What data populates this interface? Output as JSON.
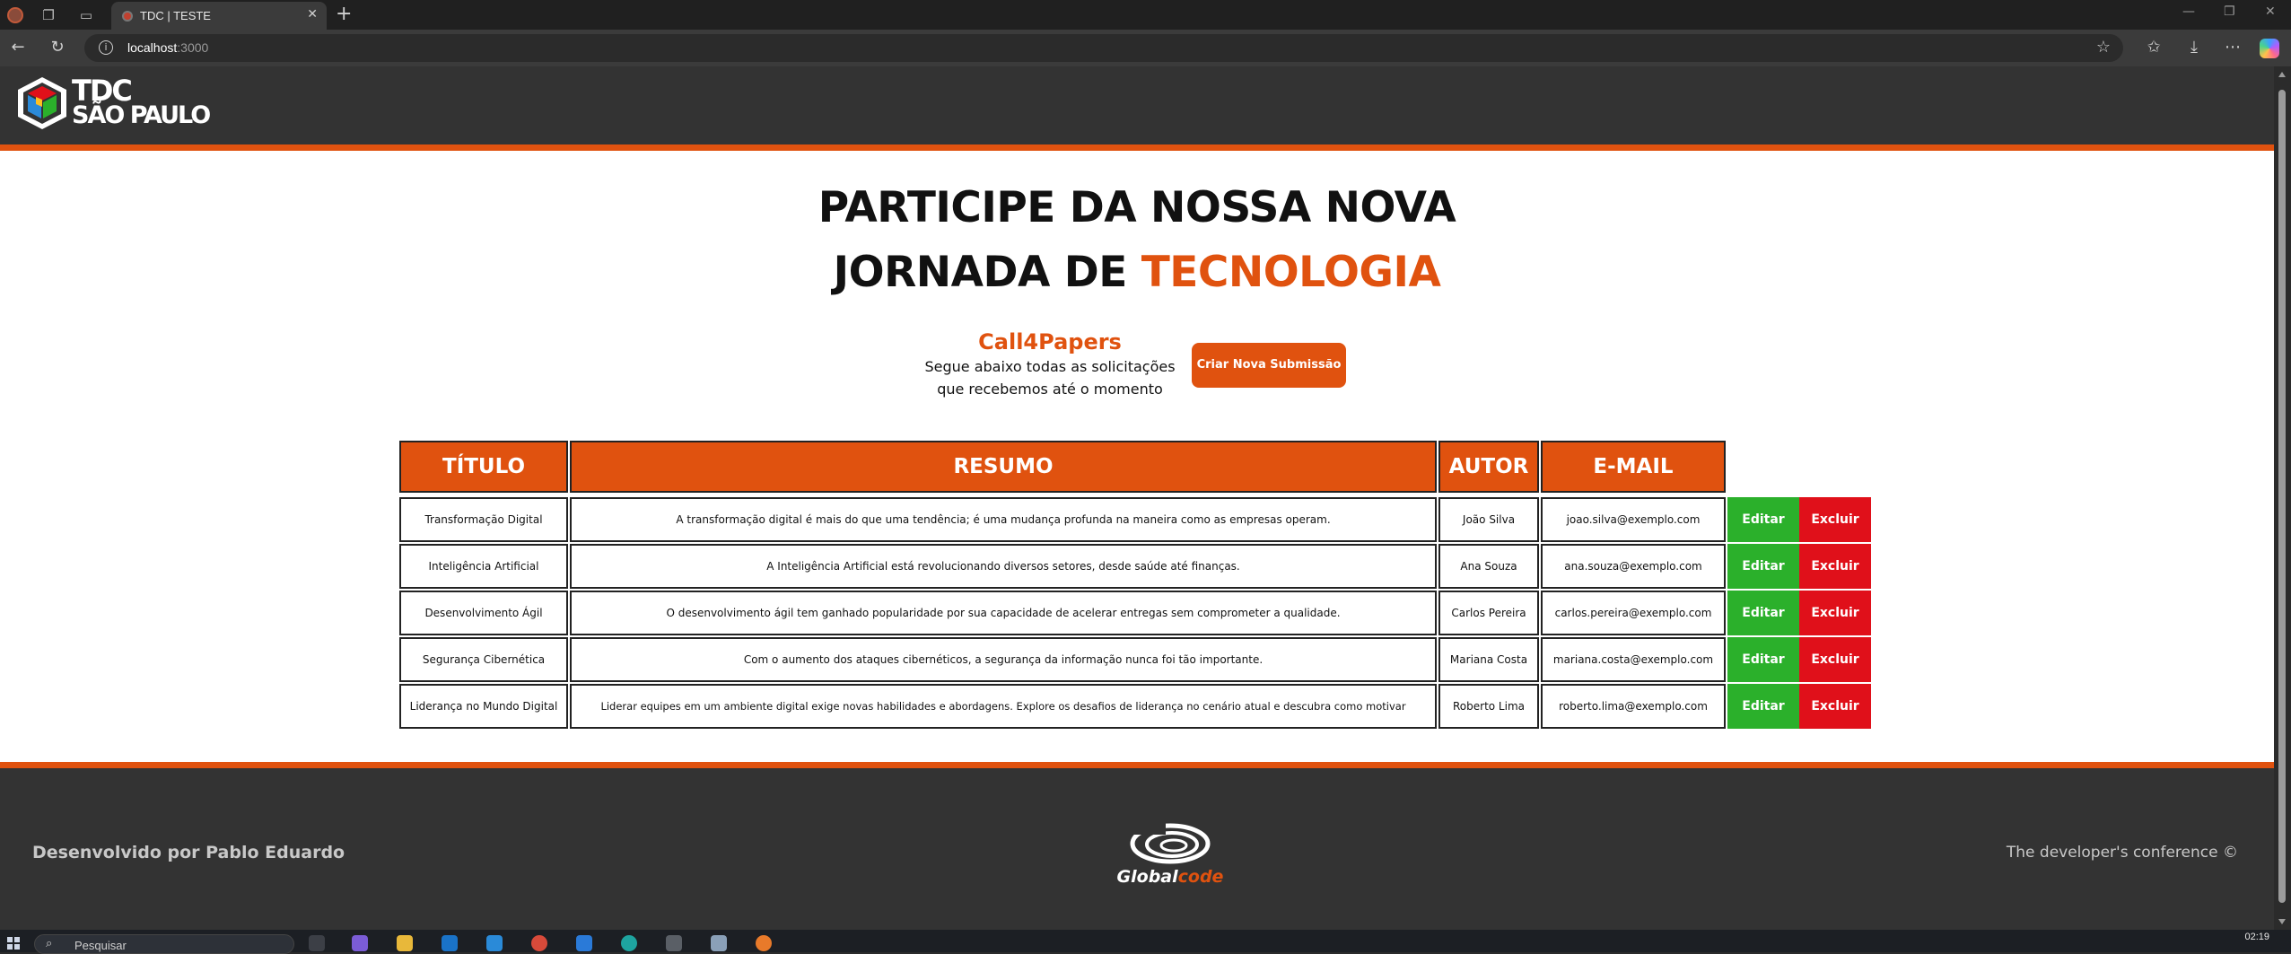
{
  "browser": {
    "tab_title": "TDC | TESTE",
    "url_host": "localhost",
    "url_port": ":3000"
  },
  "site": {
    "logo_line1": "TDC",
    "logo_line2": "SÃO PAULO",
    "hero_line1": "PARTICIPE DA NOSSA NOVA",
    "hero_line2_prefix": "JORNADA DE ",
    "hero_line2_accent": "TECNOLOGIA",
    "call_title": "Call4Papers",
    "call_sub_1": "Segue abaixo todas as solicitações",
    "call_sub_2": "que recebemos até o momento",
    "cta_label": "Criar Nova Submissão"
  },
  "table": {
    "headers": [
      "TÍTULO",
      "RESUMO",
      "AUTOR",
      "E-MAIL"
    ],
    "edit_label": "Editar",
    "delete_label": "Excluir",
    "rows": [
      {
        "titulo": "Transformação Digital",
        "resumo": "A transformação digital é mais do que uma tendência; é uma mudança profunda na maneira como as empresas operam.",
        "autor": "João Silva",
        "email": "joao.silva@exemplo.com"
      },
      {
        "titulo": "Inteligência Artificial",
        "resumo": "A Inteligência Artificial está revolucionando diversos setores, desde saúde até finanças.",
        "autor": "Ana Souza",
        "email": "ana.souza@exemplo.com"
      },
      {
        "titulo": "Desenvolvimento Ágil",
        "resumo": "O desenvolvimento ágil tem ganhado popularidade por sua capacidade de acelerar entregas sem comprometer a qualidade.",
        "autor": "Carlos Pereira",
        "email": "carlos.pereira@exemplo.com"
      },
      {
        "titulo": "Segurança Cibernética",
        "resumo": "Com o aumento dos ataques cibernéticos, a segurança da informação nunca foi tão importante.",
        "autor": "Mariana Costa",
        "email": "mariana.costa@exemplo.com"
      },
      {
        "titulo": "Liderança no Mundo Digital",
        "resumo": "Liderar equipes em um ambiente digital exige novas habilidades e abordagens. Explore os desafios de liderança no cenário atual e descubra como motivar",
        "autor": "Roberto Lima",
        "email": "roberto.lima@exemplo.com"
      }
    ]
  },
  "footer": {
    "developed_by": "Desenvolvido por Pablo Eduardo",
    "brand_prefix": "Global",
    "brand_suffix": "code",
    "tagline": "The developer's conference ©"
  },
  "taskbar": {
    "search_placeholder": "Pesquisar",
    "clock": "02:19"
  },
  "colors": {
    "accent": "#e0520f",
    "edit": "#2bb02b",
    "delete": "#e0101a",
    "header_bg": "#333333"
  },
  "icons": [
    "back-icon",
    "refresh-icon",
    "info-icon",
    "star-icon",
    "favorites-icon",
    "downloads-icon",
    "more-icon",
    "copilot-icon"
  ]
}
